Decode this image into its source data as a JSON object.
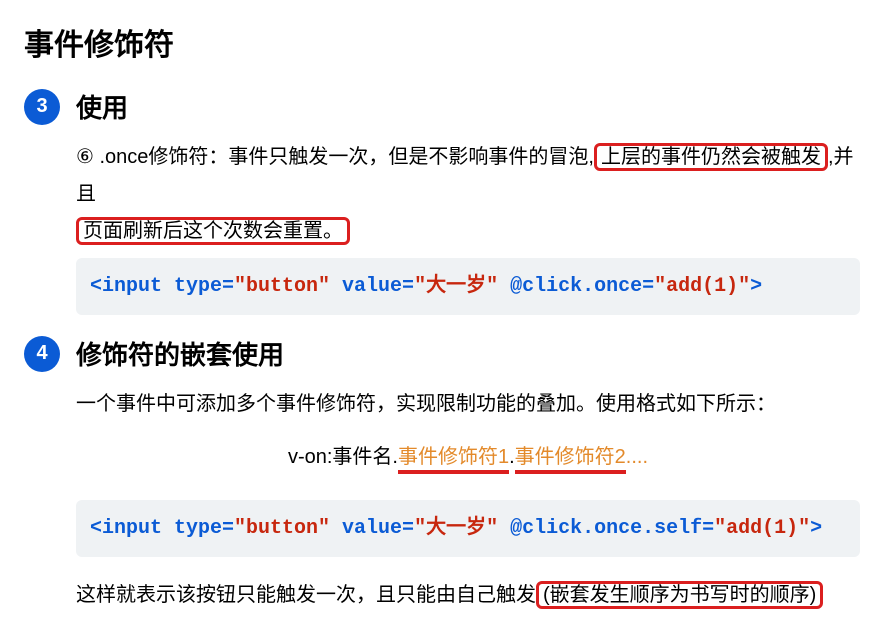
{
  "title": "事件修饰符",
  "sections": [
    {
      "num": "3",
      "heading": "使用",
      "desc_prefix": "⑥ .once修饰符：事件只触发一次，但是不影响事件的冒泡,",
      "desc_box1": "上层的事件仍然会被触发",
      "desc_mid": ",并且",
      "desc_box2": "页面刷新后这个次数会重置。",
      "code": {
        "tag_open": "<input",
        "attr_type": " type=",
        "val_type": "\"button\"",
        "attr_value": " value=",
        "val_value": "\"大一岁\"",
        "attr_click": " @click.once=",
        "val_click": "\"add(1)\"",
        "tag_close": ">"
      }
    },
    {
      "num": "4",
      "heading": "修饰符的嵌套使用",
      "desc": "一个事件中可添加多个事件修饰符，实现限制功能的叠加。使用格式如下所示：",
      "pattern": {
        "base": "v-on:事件名.",
        "mod1": "事件修饰符1",
        "dot": ".",
        "mod2": "事件修饰符2",
        "tail": "...."
      },
      "code": {
        "tag_open": "<input",
        "attr_type": " type=",
        "val_type": "\"button\"",
        "attr_value": " value=",
        "val_value": "\"大一岁\"",
        "attr_click": " @click.once.self=",
        "val_click": "\"add(1)\"",
        "tag_close": ">"
      },
      "footer_prefix": "这样就表示该按钮只能触发一次，且只能由自己触发",
      "footer_box": "(嵌套发生顺序为书写时的顺序)"
    }
  ]
}
